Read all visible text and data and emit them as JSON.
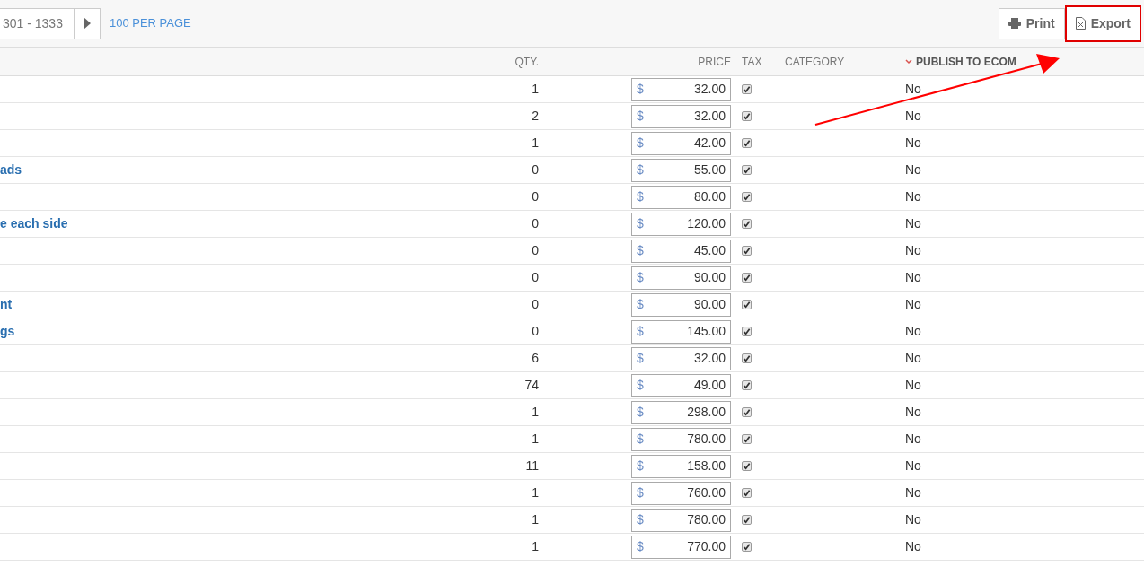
{
  "pager": {
    "range": "301 - 1333",
    "per_page": "100 PER PAGE"
  },
  "actions": {
    "print": "Print",
    "export": "Export",
    "export_highlighted": true
  },
  "columns": [
    {
      "label": "QTY.",
      "sorted": false
    },
    {
      "label": "PRICE",
      "sorted": false
    },
    {
      "label": "TAX",
      "sorted": false
    },
    {
      "label": "CATEGORY",
      "sorted": false
    },
    {
      "label": "PUBLISH TO ECOM",
      "sorted": true
    }
  ],
  "rows": [
    {
      "qty": "1",
      "currency": "$",
      "price": "32.00",
      "tax": true,
      "publish": "No"
    },
    {
      "qty": "2",
      "currency": "$",
      "price": "32.00",
      "tax": true,
      "publish": "No"
    },
    {
      "qty": "1",
      "currency": "$",
      "price": "42.00",
      "tax": true,
      "publish": "No"
    },
    {
      "name": "ads",
      "qty": "0",
      "currency": "$",
      "price": "55.00",
      "tax": true,
      "publish": "No"
    },
    {
      "qty": "0",
      "currency": "$",
      "price": "80.00",
      "tax": true,
      "publish": "No"
    },
    {
      "name": "e each side",
      "qty": "0",
      "currency": "$",
      "price": "120.00",
      "tax": true,
      "publish": "No"
    },
    {
      "qty": "0",
      "currency": "$",
      "price": "45.00",
      "tax": true,
      "publish": "No"
    },
    {
      "qty": "0",
      "currency": "$",
      "price": "90.00",
      "tax": true,
      "publish": "No"
    },
    {
      "name": "nt",
      "qty": "0",
      "currency": "$",
      "price": "90.00",
      "tax": true,
      "publish": "No"
    },
    {
      "name": "gs",
      "qty": "0",
      "currency": "$",
      "price": "145.00",
      "tax": true,
      "publish": "No"
    },
    {
      "qty": "6",
      "currency": "$",
      "price": "32.00",
      "tax": true,
      "publish": "No"
    },
    {
      "qty": "74",
      "currency": "$",
      "price": "49.00",
      "tax": true,
      "publish": "No"
    },
    {
      "qty": "1",
      "currency": "$",
      "price": "298.00",
      "tax": true,
      "publish": "No"
    },
    {
      "qty": "1",
      "currency": "$",
      "price": "780.00",
      "tax": true,
      "publish": "No"
    },
    {
      "qty": "11",
      "currency": "$",
      "price": "158.00",
      "tax": true,
      "publish": "No"
    },
    {
      "qty": "1",
      "currency": "$",
      "price": "760.00",
      "tax": true,
      "publish": "No"
    },
    {
      "qty": "1",
      "currency": "$",
      "price": "780.00",
      "tax": true,
      "publish": "No"
    },
    {
      "qty": "1",
      "currency": "$",
      "price": "770.00",
      "tax": true,
      "publish": "No"
    }
  ]
}
